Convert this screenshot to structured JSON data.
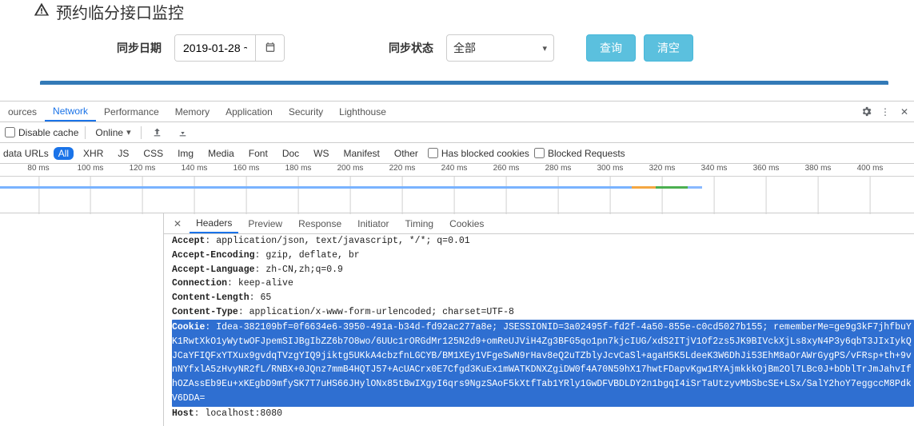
{
  "page": {
    "title": "预约临分接口监控"
  },
  "form": {
    "date_label": "同步日期",
    "date_value": "2019-01-28 ~",
    "status_label": "同步状态",
    "status_value": "全部",
    "btn_query": "查询",
    "btn_clear": "清空"
  },
  "devtools": {
    "tabs": [
      "ources",
      "Network",
      "Performance",
      "Memory",
      "Application",
      "Security",
      "Lighthouse"
    ],
    "active_tab": "Network",
    "toolbar": {
      "disable_cache": "Disable cache",
      "throttling": "Online"
    },
    "filter": {
      "label": "data URLs",
      "types": [
        "All",
        "XHR",
        "JS",
        "CSS",
        "Img",
        "Media",
        "Font",
        "Doc",
        "WS",
        "Manifest",
        "Other"
      ],
      "active_type": "All",
      "blocked_cookies": "Has blocked cookies",
      "blocked_requests": "Blocked Requests"
    },
    "timeline": {
      "ticks": [
        "80 ms",
        "100 ms",
        "120 ms",
        "140 ms",
        "160 ms",
        "180 ms",
        "200 ms",
        "220 ms",
        "240 ms",
        "260 ms",
        "280 ms",
        "300 ms",
        "320 ms",
        "340 ms",
        "360 ms",
        "380 ms",
        "400 ms"
      ]
    },
    "detail_tabs": [
      "Headers",
      "Preview",
      "Response",
      "Initiator",
      "Timing",
      "Cookies"
    ],
    "active_detail_tab": "Headers",
    "headers": {
      "accept": {
        "k": "Accept",
        "v": "application/json, text/javascript, */*; q=0.01"
      },
      "accept_encoding": {
        "k": "Accept-Encoding",
        "v": "gzip, deflate, br"
      },
      "accept_language": {
        "k": "Accept-Language",
        "v": "zh-CN,zh;q=0.9"
      },
      "connection": {
        "k": "Connection",
        "v": "keep-alive"
      },
      "content_length": {
        "k": "Content-Length",
        "v": "65"
      },
      "content_type": {
        "k": "Content-Type",
        "v": "application/x-www-form-urlencoded; charset=UTF-8"
      },
      "cookie": {
        "k": "Cookie",
        "v": "Idea-382109bf=0f6634e6-3950-491a-b34d-fd92ac277a8e; JSESSIONID=3a02495f-fd2f-4a50-855e-c0cd5027b155; rememberMe=ge9g3kF7jhfbuYK1RwtXkO1yWytwOFJpemSIJBgIbZZ6b7O8wo/6UUc1rORGdMr125N2d9+omReUJViH4Zg3BFG5qo1pn7kjcIUG/xdS2ITjV1Of2zs5JK9BIVckXjLs8xyN4P3y6qbT3JIxIykQJCaYFIQFxYTXux9gvdqTVzgYIQ9jiktg5UKkA4cbzfnLGCYB/BM1XEy1VFgeSwN9rHav8eQ2uTZblyJcvCaSl+agaH5K5LdeeK3W6DhJi53EhM8aOrAWrGygPS/vFRsp+th+9vnNYfxlA5zHvyNR2fL/RNBX+0JQnz7mmB4HQTJ57+AcUACrx0E7Cfgd3KuEx1mWATKDNXZgiDW0f4A70N59hX17hwtFDapvKgw1RYAjmkkkOjBm2Ol7LBc0J+bDblTrJmJahvIfhOZAssEb9Eu+xKEgbD9mfySK7T7uHS66JHylONx85tBwIXgyI6qrs9NgzSAoF5kXtfTab1YRly1GwDFVBDLDY2n1bgqI4iSrTaUtzyvMbSbcSE+LSx/SalY2hoY7eggccM8PdkV6DDA="
      },
      "host": {
        "k": "Host",
        "v": "localhost:8080"
      }
    }
  }
}
